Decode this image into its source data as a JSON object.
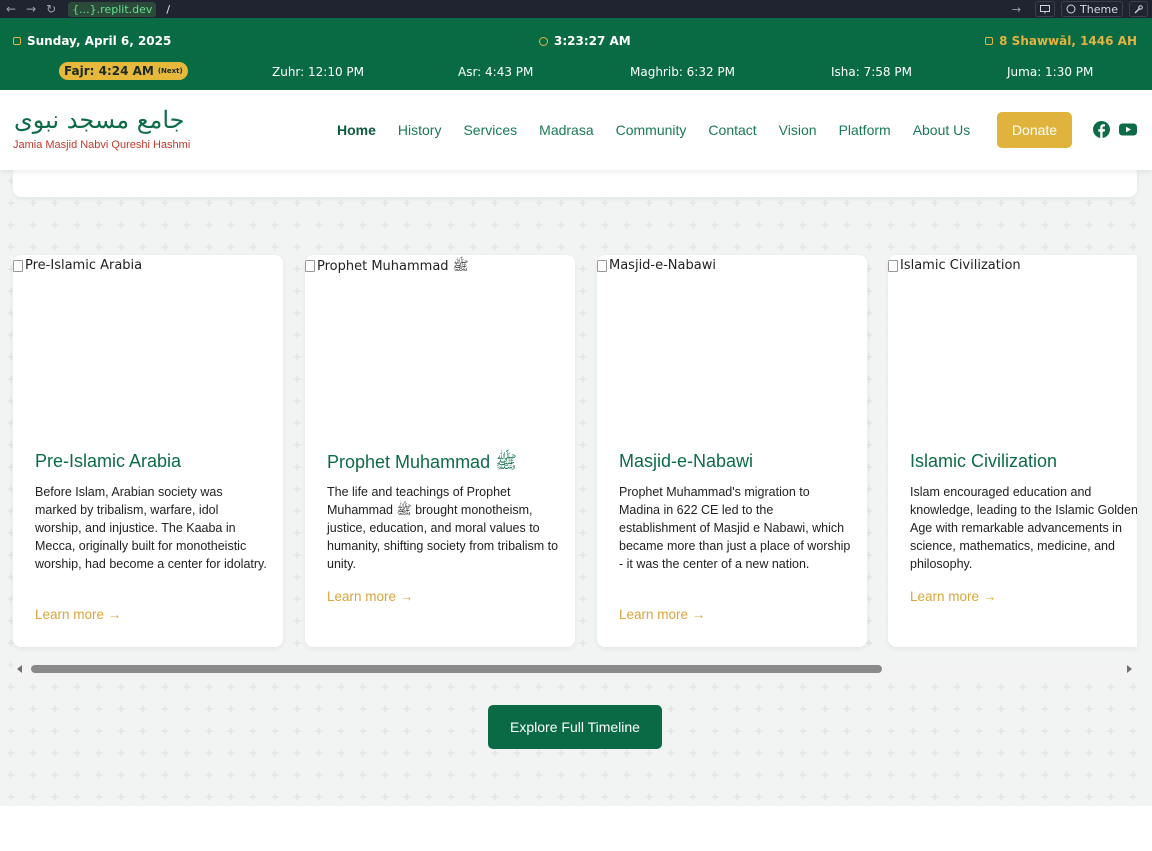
{
  "browser": {
    "back": "←",
    "forward": "→",
    "reload": "↻",
    "host": "{...}.replit.dev",
    "path": "/",
    "open_arrow": "→",
    "theme_label": "Theme"
  },
  "prayer_bar": {
    "date": "Sunday, April 6, 2025",
    "time": "3:23:27 AM",
    "hijri": "8 Shawwāl, 1446 AH",
    "next_tag": "(Next)",
    "prayers": [
      {
        "label": "Fajr: 4:24 AM"
      },
      {
        "label": "Zuhr: 12:10 PM"
      },
      {
        "label": "Asr: 4:43 PM"
      },
      {
        "label": "Maghrib: 6:32 PM"
      },
      {
        "label": "Isha: 7:58 PM"
      },
      {
        "label": "Juma: 1:30 PM"
      }
    ]
  },
  "header": {
    "logo_arabic": "جامع مسجد نبوی",
    "logo_english": "Jamia Masjid Nabvi Qureshi Hashmi",
    "nav": [
      "Home",
      "History",
      "Services",
      "Madrasa",
      "Community",
      "Contact",
      "Vision",
      "Platform",
      "About Us"
    ],
    "donate": "Donate",
    "social": [
      "facebook-icon",
      "youtube-icon"
    ]
  },
  "cards": [
    {
      "image_alt": "Pre-Islamic Arabia",
      "title": "Pre-Islamic Arabia",
      "text": "Before Islam, Arabian society was marked by tribalism, warfare, idol worship, and injustice. The Kaaba in Mecca, originally built for monotheistic worship, had become a center for idolatry.",
      "link": "Learn more →"
    },
    {
      "image_alt": "Prophet Muhammad ﷺ",
      "title": "Prophet Muhammad ﷺ",
      "text": "The life and teachings of Prophet Muhammad ﷺ brought monotheism, justice, education, and moral values to humanity, shifting society from tribalism to unity.",
      "link": "Learn more →"
    },
    {
      "image_alt": "Masjid-e-Nabawi",
      "title": "Masjid-e-Nabawi",
      "text": "Prophet Muhammad's migration to Madina in 622 CE led to the establishment of Masjid e Nabawi, which became more than just a place of worship - it was the center of a new nation.",
      "link": "Learn more →"
    },
    {
      "image_alt": "Islamic Civilization",
      "title": "Islamic Civilization",
      "text": "Islam encouraged education and knowledge, leading to the Islamic Golden Age with remarkable advancements in science, mathematics, medicine, and philosophy.",
      "link": "Learn more →"
    }
  ],
  "explore_button": "Explore Full Timeline",
  "colors": {
    "primary_green": "#096b44",
    "accent_gold": "#e0b33c",
    "logo_subtitle_red": "#c0392b"
  }
}
